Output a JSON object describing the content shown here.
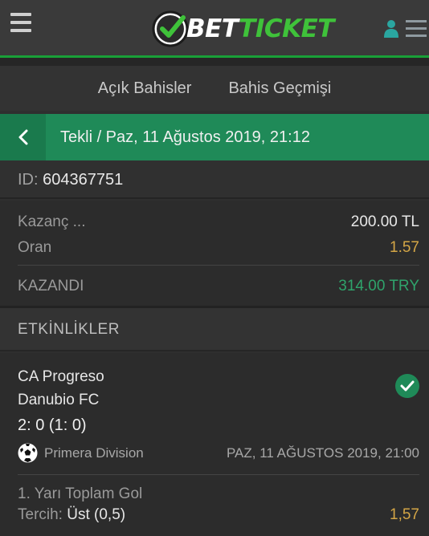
{
  "header": {
    "brand_prefix": "BET",
    "brand_suffix": "TICKET"
  },
  "tabs": [
    {
      "label": "Açık Bahisler"
    },
    {
      "label": "Bahis Geçmişi"
    }
  ],
  "bet": {
    "title": "Tekli / Paz, 11 Ağustos 2019, 21:12",
    "id_label": "ID:",
    "id_value": "604367751",
    "stake_label": "Kazanç ...",
    "stake_value": "200.00 TL",
    "odds_label": "Oran",
    "odds_value": "1.57",
    "status_label": "KAZANDI",
    "payout_value": "314.00 TRY"
  },
  "events_title": "ETKİNLİKLER",
  "event": {
    "home": "CA Progreso",
    "away": "Danubio FC",
    "score": "2: 0 (1: 0)",
    "league": "Primera Division",
    "date": "PAZ, 11 AĞUSTOS 2019, 21:00",
    "market": "1. Yarı Toplam Gol",
    "pick_label": "Tercih:",
    "pick_value": "Üst (0,5)",
    "pick_odds": "1,57"
  },
  "colors": {
    "accent_green": "#1f8a58",
    "odds_gold": "#d4a646",
    "win_green": "#2fa36b",
    "brand_green": "#3fc23a"
  },
  "icons": [
    "hamburger-icon",
    "logo-check-icon",
    "user-icon",
    "menu-icon",
    "back-chevron-icon",
    "check-circle-icon",
    "soccer-ball-icon"
  ]
}
